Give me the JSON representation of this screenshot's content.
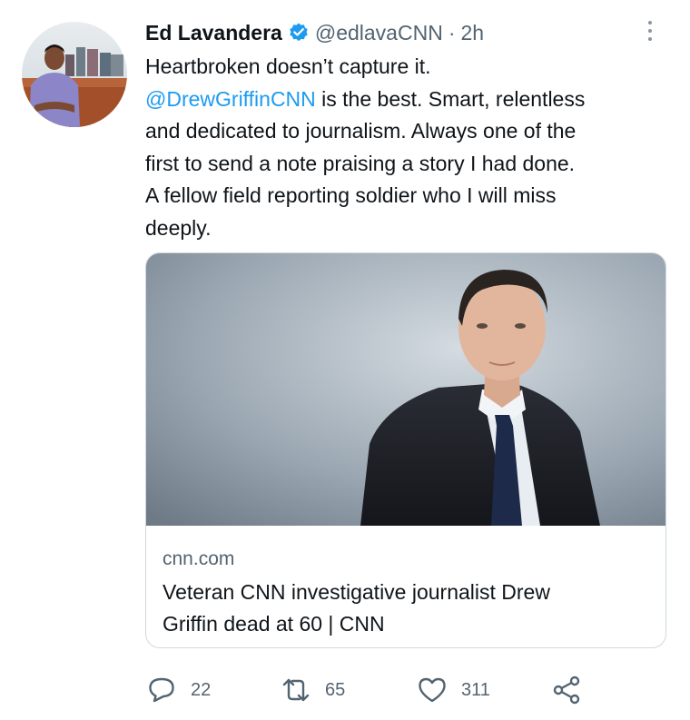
{
  "tweet": {
    "author_name": "Ed Lavandera",
    "handle": "@edlavaCNN",
    "separator": "·",
    "time": "2h",
    "text_line1": "Heartbroken doesn’t capture it.",
    "mention": "@DrewGriffinCNN",
    "text_line2_rest": " is the best. Smart, relentless",
    "text_line3": "and dedicated to journalism. Always one of the",
    "text_line4": "first to send a note praising a story I had done.",
    "text_line5": "A fellow field reporting soldier who I will miss",
    "text_line6": "deeply."
  },
  "card": {
    "domain": "cnn.com",
    "title_line1": "Veteran CNN investigative journalist Drew",
    "title_line2": "Griffin dead at 60 | CNN"
  },
  "actions": {
    "replies": "22",
    "retweets": "65",
    "likes": "311"
  },
  "colors": {
    "accent": "#1d9bf0",
    "secondary_text": "#536471",
    "primary_text": "#0f1419",
    "border": "#cfd9de"
  },
  "icons": [
    "verified-badge-icon",
    "more-options-icon",
    "reply-icon",
    "retweet-icon",
    "like-icon",
    "share-icon"
  ]
}
